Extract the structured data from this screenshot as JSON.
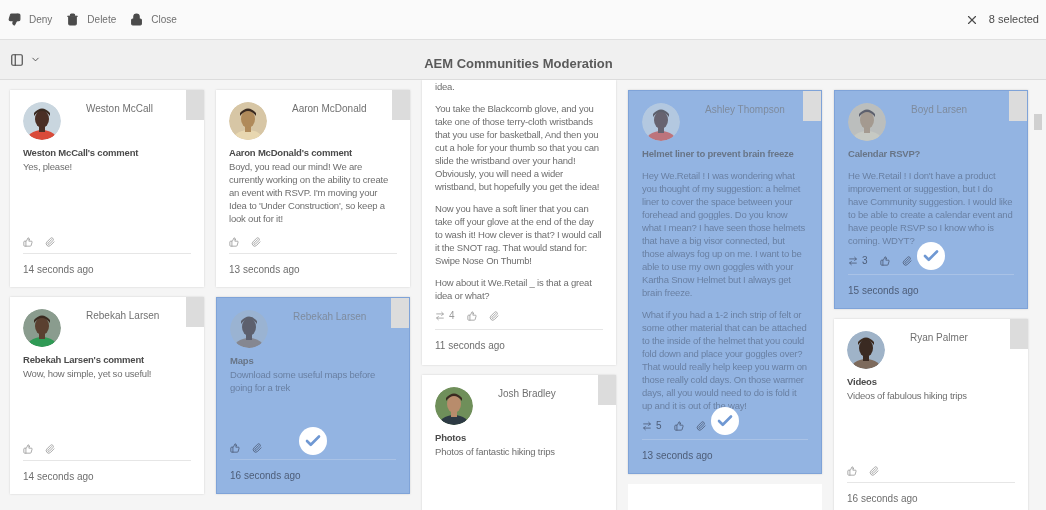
{
  "toolbar": {
    "actions": [
      {
        "kind": "deny",
        "label": "Deny"
      },
      {
        "kind": "delete",
        "label": "Delete"
      },
      {
        "kind": "close",
        "label": "Close"
      }
    ],
    "selection_count": "8 selected"
  },
  "title": "AEM Communities Moderation",
  "columns": [
    {
      "cards": [
        {
          "kind": "post",
          "selected": false,
          "author": "Weston McCall",
          "title": "Weston McCall's comment",
          "paragraphs": [
            "Yes, please!"
          ],
          "time": "14 seconds ago"
        },
        {
          "kind": "post",
          "selected": false,
          "author": "Rebekah Larsen",
          "title": "Rebekah Larsen's comment",
          "paragraphs": [
            "Wow, how simple, yet so useful!"
          ],
          "time": "14 seconds ago"
        }
      ]
    },
    {
      "cards": [
        {
          "kind": "post",
          "selected": false,
          "author": "Aaron McDonald",
          "title": "Aaron McDonald's comment",
          "paragraphs": [
            "Boyd, you read our mind! We are currently working on the ability to create an event with RSVP. I'm moving your Idea to 'Under Construction', so keep a look out for it!"
          ],
          "time": "13 seconds ago"
        },
        {
          "kind": "post",
          "selected": true,
          "author": "Rebekah Larsen",
          "title": "Maps",
          "paragraphs": [
            "Download some useful maps before going for a trek"
          ],
          "time": "16 seconds ago"
        }
      ]
    },
    {
      "cards": [
        {
          "kind": "partial",
          "selected": false,
          "paragraphs": [
            "idea.",
            "You take the Blackcomb glove, and you take one of those terry-cloth wristbands that you use for basketball, And then you cut a hole for your thumb so that you can slide the wristband over your hand! Obviously, you will need a wider wristband, but hopefully you get the idea!",
            "Now you have a soft liner that you can take off your glove at the end of the day to wash it! How clever is that? I would call it the SNOT rag. That would stand for: Swipe Nose On Thumb!",
            "How about it We.Retail _ is that a great idea or what?"
          ],
          "votes": "4",
          "time": "11 seconds ago"
        },
        {
          "kind": "post",
          "selected": false,
          "author": "Josh Bradley",
          "title": "Photos",
          "paragraphs": [
            "Photos of fantastic hiking trips"
          ]
        }
      ]
    },
    {
      "cards": [
        {
          "kind": "post",
          "selected": true,
          "author": "Ashley Thompson",
          "title": "Helmet liner to prevent brain freeze",
          "paragraphs": [
            "Hey We.Retail ! I was wondering what you thought of my suggestion: a helmet liner to cover the space between your forehead and goggles. Do you know what I mean? I have seen those helmets that have a big visor connected, but those always fog up on me. I want to be able to use my own goggles with your Kartha Snow Helmet but I always get brain freeze.",
            "What if you had a 1-2 inch strip of felt or some other material that can be attached to the inside of the helmet that you could fold down and place your goggles over? That would really help keep you warm on those really cold days. On those warmer days, all you would need to do is fold it up and it is out of the way!"
          ],
          "votes": "5",
          "time": "13 seconds ago"
        },
        {
          "kind": "empty",
          "selected": false
        }
      ]
    },
    {
      "cards": [
        {
          "kind": "post",
          "selected": true,
          "author": "Boyd Larsen",
          "title": "Calendar RSVP?",
          "paragraphs": [
            "He We.Retail ! I don't have a product improvement or suggestion, but I do have Community suggestion. I would like to be able to create a calendar event and have people RSVP so I know who is coming. WDYT?"
          ],
          "votes": "3",
          "time": "15 seconds ago"
        },
        {
          "kind": "post",
          "selected": false,
          "author": "Ryan Palmer",
          "title": "Videos",
          "paragraphs": [
            "Videos of fabulous hiking trips"
          ],
          "time": "16 seconds ago"
        }
      ]
    }
  ]
}
